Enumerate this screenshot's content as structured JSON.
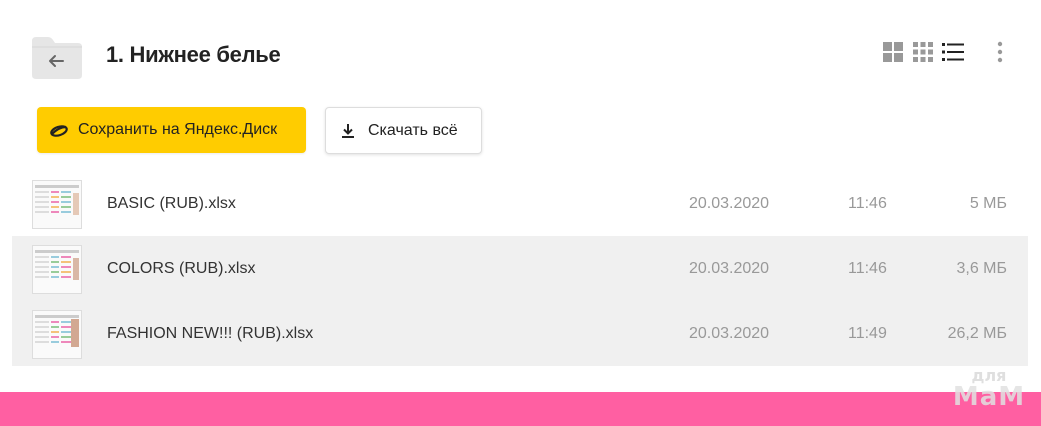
{
  "header": {
    "title": "1. Нижнее белье",
    "back_icon": "arrow-left-icon",
    "view_modes": [
      "grid-large-icon",
      "grid-small-icon",
      "list-icon"
    ],
    "active_view": "list-icon",
    "more_icon": "more-vertical-icon"
  },
  "actions": {
    "save_label": "Сохранить на Яндекс.Диск",
    "download_label": "Скачать всё"
  },
  "files": [
    {
      "name": "BASIC (RUB).xlsx",
      "date": "20.03.2020",
      "time": "11:46",
      "size": "5 МБ",
      "selected": false
    },
    {
      "name": "COLORS (RUB).xlsx",
      "date": "20.03.2020",
      "time": "11:46",
      "size": "3,6 МБ",
      "selected": true
    },
    {
      "name": "FASHION NEW!!! (RUB).xlsx",
      "date": "20.03.2020",
      "time": "11:49",
      "size": "26,2 МБ",
      "selected": true
    }
  ],
  "watermark": {
    "line1": "для",
    "line2": "МаМ"
  },
  "colors": {
    "accent_yellow": "#ffcc00",
    "selected_row": "#f0f0f0",
    "footer_pink": "#ff5fa2"
  }
}
